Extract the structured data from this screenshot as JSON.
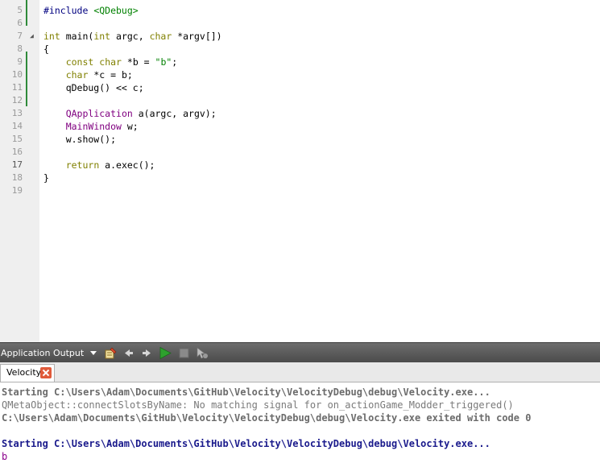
{
  "editor": {
    "line_numbers": [
      "5",
      "6",
      "7",
      "8",
      "9",
      "10",
      "11",
      "12",
      "13",
      "14",
      "15",
      "16",
      "17",
      "18",
      "19"
    ],
    "current_line": "17",
    "lines": [
      [
        {
          "t": "#include ",
          "c": "pp"
        },
        {
          "t": "<QDebug>",
          "c": "inc"
        }
      ],
      [],
      [
        {
          "t": "int",
          "c": "kw"
        },
        {
          "t": " main(",
          "c": ""
        },
        {
          "t": "int",
          "c": "kw"
        },
        {
          "t": " argc, ",
          "c": ""
        },
        {
          "t": "char",
          "c": "kw"
        },
        {
          "t": " *argv[])",
          "c": ""
        }
      ],
      [
        {
          "t": "{",
          "c": ""
        }
      ],
      [
        {
          "t": "    ",
          "c": ""
        },
        {
          "t": "const",
          "c": "kw"
        },
        {
          "t": " ",
          "c": ""
        },
        {
          "t": "char",
          "c": "kw"
        },
        {
          "t": " *b = ",
          "c": ""
        },
        {
          "t": "\"b\"",
          "c": "str"
        },
        {
          "t": ";",
          "c": ""
        }
      ],
      [
        {
          "t": "    ",
          "c": ""
        },
        {
          "t": "char",
          "c": "kw"
        },
        {
          "t": " *c = b;",
          "c": ""
        }
      ],
      [
        {
          "t": "    qDebug() << c;",
          "c": ""
        }
      ],
      [],
      [
        {
          "t": "    ",
          "c": ""
        },
        {
          "t": "QApplication",
          "c": "typ"
        },
        {
          "t": " a(argc, argv);",
          "c": ""
        }
      ],
      [
        {
          "t": "    ",
          "c": ""
        },
        {
          "t": "MainWindow",
          "c": "typ"
        },
        {
          "t": " w;",
          "c": ""
        }
      ],
      [
        {
          "t": "    w.show();",
          "c": ""
        }
      ],
      [],
      [
        {
          "t": "    ",
          "c": ""
        },
        {
          "t": "return",
          "c": "kw"
        },
        {
          "t": " a.exec();",
          "c": ""
        }
      ],
      [
        {
          "t": "}",
          "c": ""
        }
      ],
      []
    ]
  },
  "output_pane": {
    "selector_label": "Application Output",
    "tab_label": "Velocity",
    "lines": [
      "Starting C:\\Users\\Adam\\Documents\\GitHub\\Velocity\\VelocityDebug\\debug\\Velocity.exe...",
      "QMetaObject::connectSlotsByName: No matching signal for on_actionGame_Modder_triggered()",
      "C:\\Users\\Adam\\Documents\\GitHub\\Velocity\\VelocityDebug\\debug\\Velocity.exe exited with code 0",
      "",
      "Starting C:\\Users\\Adam\\Documents\\GitHub\\Velocity\\VelocityDebug\\debug\\Velocity.exe...",
      "b"
    ]
  },
  "icons": {
    "toolbar": [
      "clear-output-icon",
      "previous-item-icon",
      "next-item-icon",
      "rerun-icon",
      "stop-icon",
      "attach-debugger-icon"
    ],
    "tab_close": "close-icon",
    "fold_marker": "fold-triangle-icon"
  },
  "colors": {
    "keyword": "#808000",
    "type": "#800080",
    "string": "#008000",
    "preprocessor": "#000080",
    "modified_marker": "#2f8a3a",
    "run_green": "#2ea12e",
    "second_run": "#1a1a8c",
    "program_output": "#8b008b"
  }
}
